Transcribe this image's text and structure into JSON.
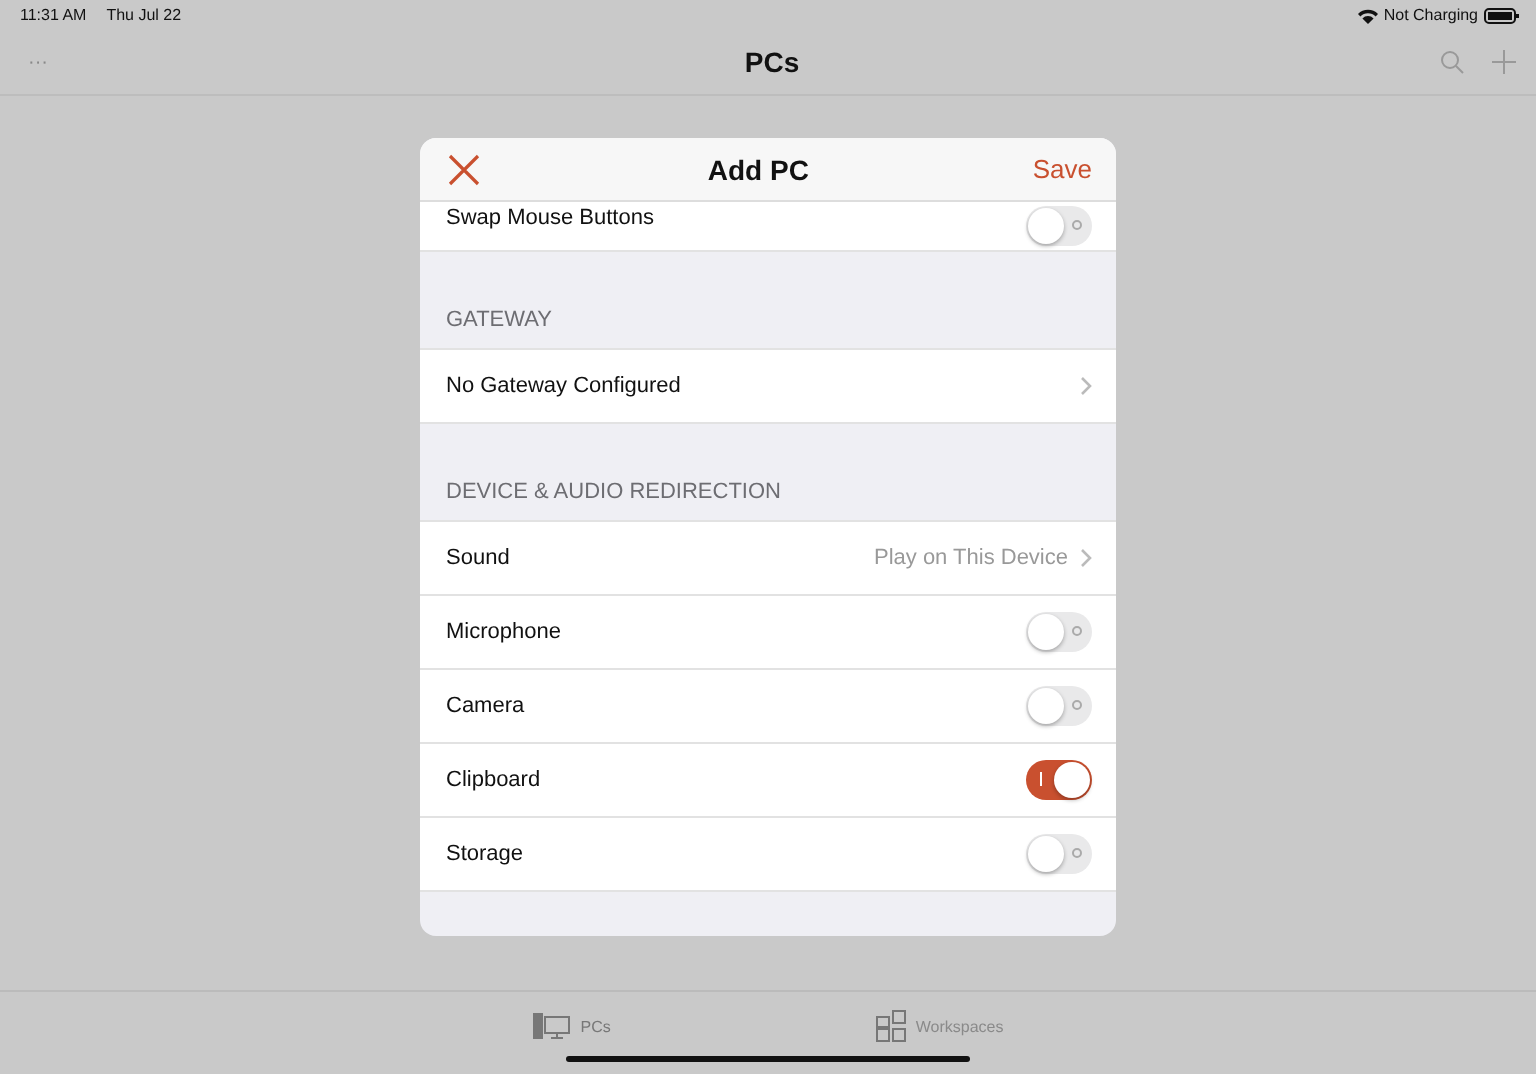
{
  "status_bar": {
    "time": "11:31 AM",
    "date": "Thu Jul 22",
    "charging": "Not Charging"
  },
  "nav_bar": {
    "title": "PCs",
    "more": "···"
  },
  "dialog": {
    "title": "Add PC",
    "save": "Save",
    "top_row": {
      "label": "Swap Mouse Buttons",
      "kind": "toggle",
      "on": false
    },
    "sections": [
      {
        "header": "GATEWAY",
        "rows": [
          {
            "label": "No Gateway Configured",
            "kind": "disclosure"
          }
        ]
      },
      {
        "header": "DEVICE & AUDIO REDIRECTION",
        "rows": [
          {
            "label": "Sound",
            "kind": "disclosure",
            "value": "Play on This Device"
          },
          {
            "label": "Microphone",
            "kind": "toggle",
            "on": false
          },
          {
            "label": "Camera",
            "kind": "toggle",
            "on": false
          },
          {
            "label": "Clipboard",
            "kind": "toggle",
            "on": true
          },
          {
            "label": "Storage",
            "kind": "toggle",
            "on": false
          }
        ]
      }
    ]
  },
  "tab_bar": [
    {
      "label": "PCs",
      "kind": "pc",
      "selected": true
    },
    {
      "label": "Workspaces",
      "kind": "grid",
      "selected": false
    }
  ]
}
